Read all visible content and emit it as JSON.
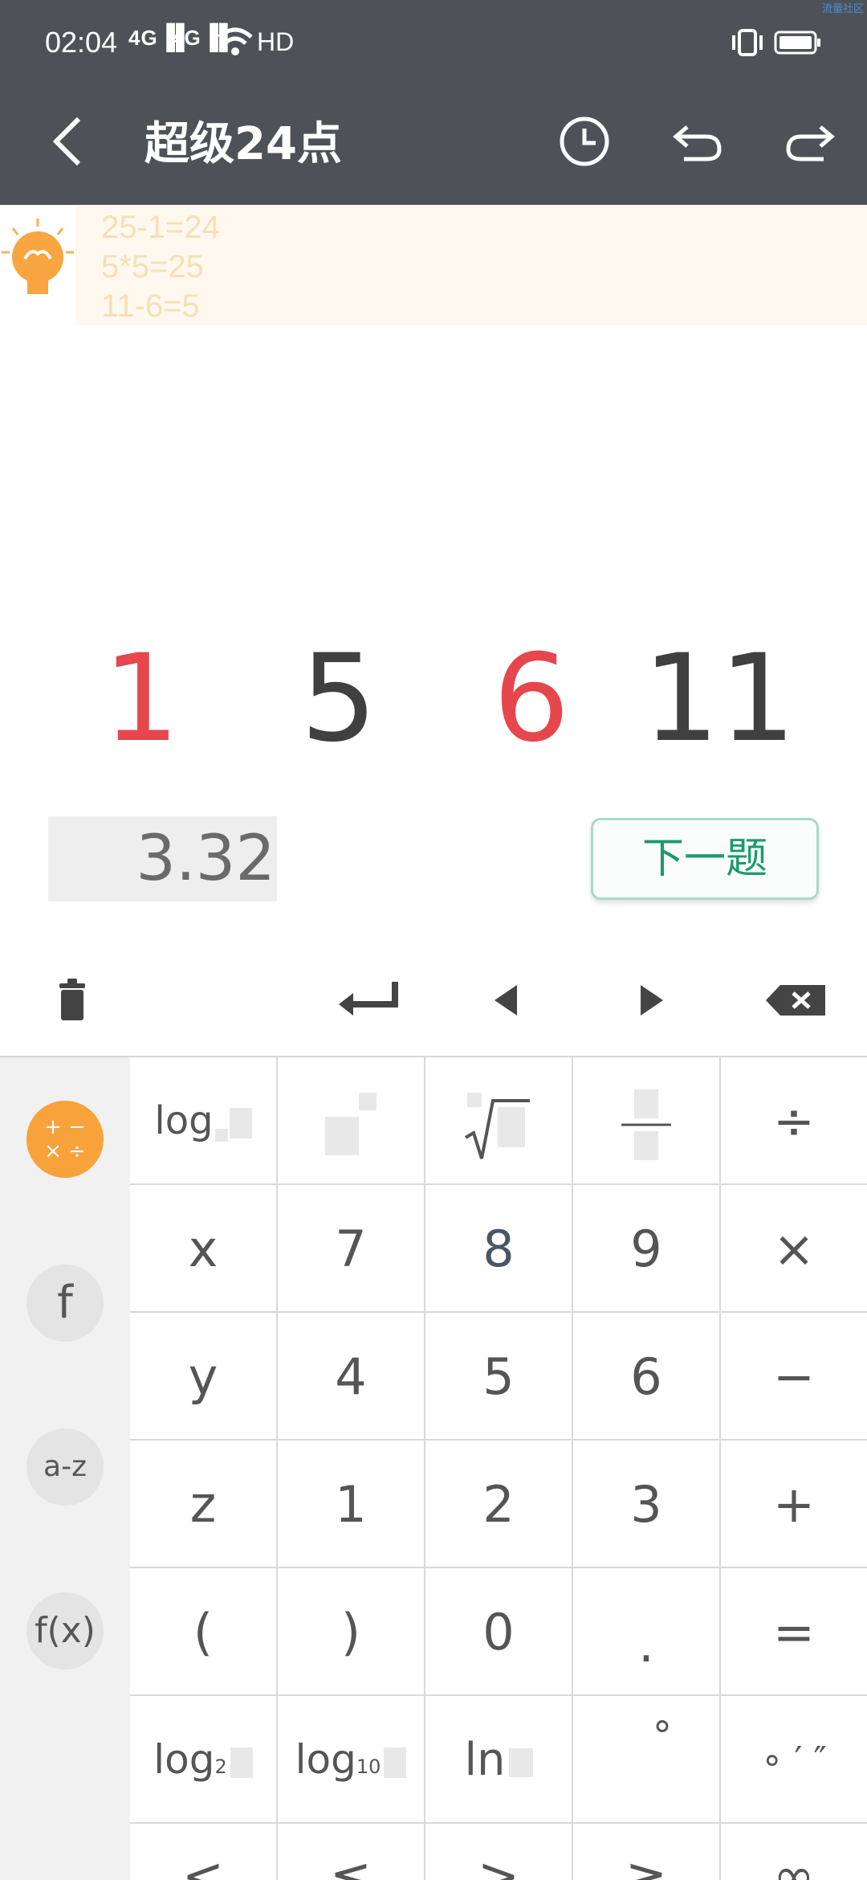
{
  "status": {
    "time": "02:04",
    "sig1": "4G",
    "sig2": "4G",
    "hd": "HD",
    "corner": "流量社区"
  },
  "header": {
    "title": "超级24点",
    "back_icon": "back-arrow-icon",
    "history_icon": "clock-icon",
    "undo_icon": "undo-icon",
    "redo_icon": "redo-icon"
  },
  "hint": {
    "icon": "lightbulb-icon",
    "lines": [
      "25-1=24",
      "5*5=25",
      "11-6=5"
    ]
  },
  "numbers": [
    {
      "value": "1",
      "color": "#e5474d"
    },
    {
      "value": "5",
      "color": "#404040"
    },
    {
      "value": "6",
      "color": "#e5474d"
    },
    {
      "value": "11",
      "color": "#404040"
    }
  ],
  "timer": "3.32",
  "next_button": "下一题",
  "toolbar": {
    "delete": "trash-icon",
    "enter": "enter-icon",
    "left": "caret-left-icon",
    "right": "caret-right-icon",
    "backspace": "backspace-icon"
  },
  "sidebar": [
    {
      "label": "+ −\n× ÷",
      "icon": "arithmetic-icon"
    },
    {
      "label": "f"
    },
    {
      "label": "a-z"
    },
    {
      "label": "f(x)"
    }
  ],
  "keys": {
    "r1": [
      "log",
      "",
      "",
      "",
      "÷"
    ],
    "r2": [
      "x",
      "7",
      "8",
      "9",
      "×"
    ],
    "r3": [
      "y",
      "4",
      "5",
      "6",
      "−"
    ],
    "r4": [
      "z",
      "1",
      "2",
      "3",
      "+"
    ],
    "r5": [
      "(",
      ")",
      "0",
      ".",
      "="
    ],
    "r6": [
      "log",
      "log",
      "ln",
      "°",
      "∘ ′ ″"
    ],
    "r6_sub": [
      "2",
      "10"
    ],
    "r7": [
      "<",
      "≤",
      ">",
      "≥",
      "∞"
    ]
  }
}
